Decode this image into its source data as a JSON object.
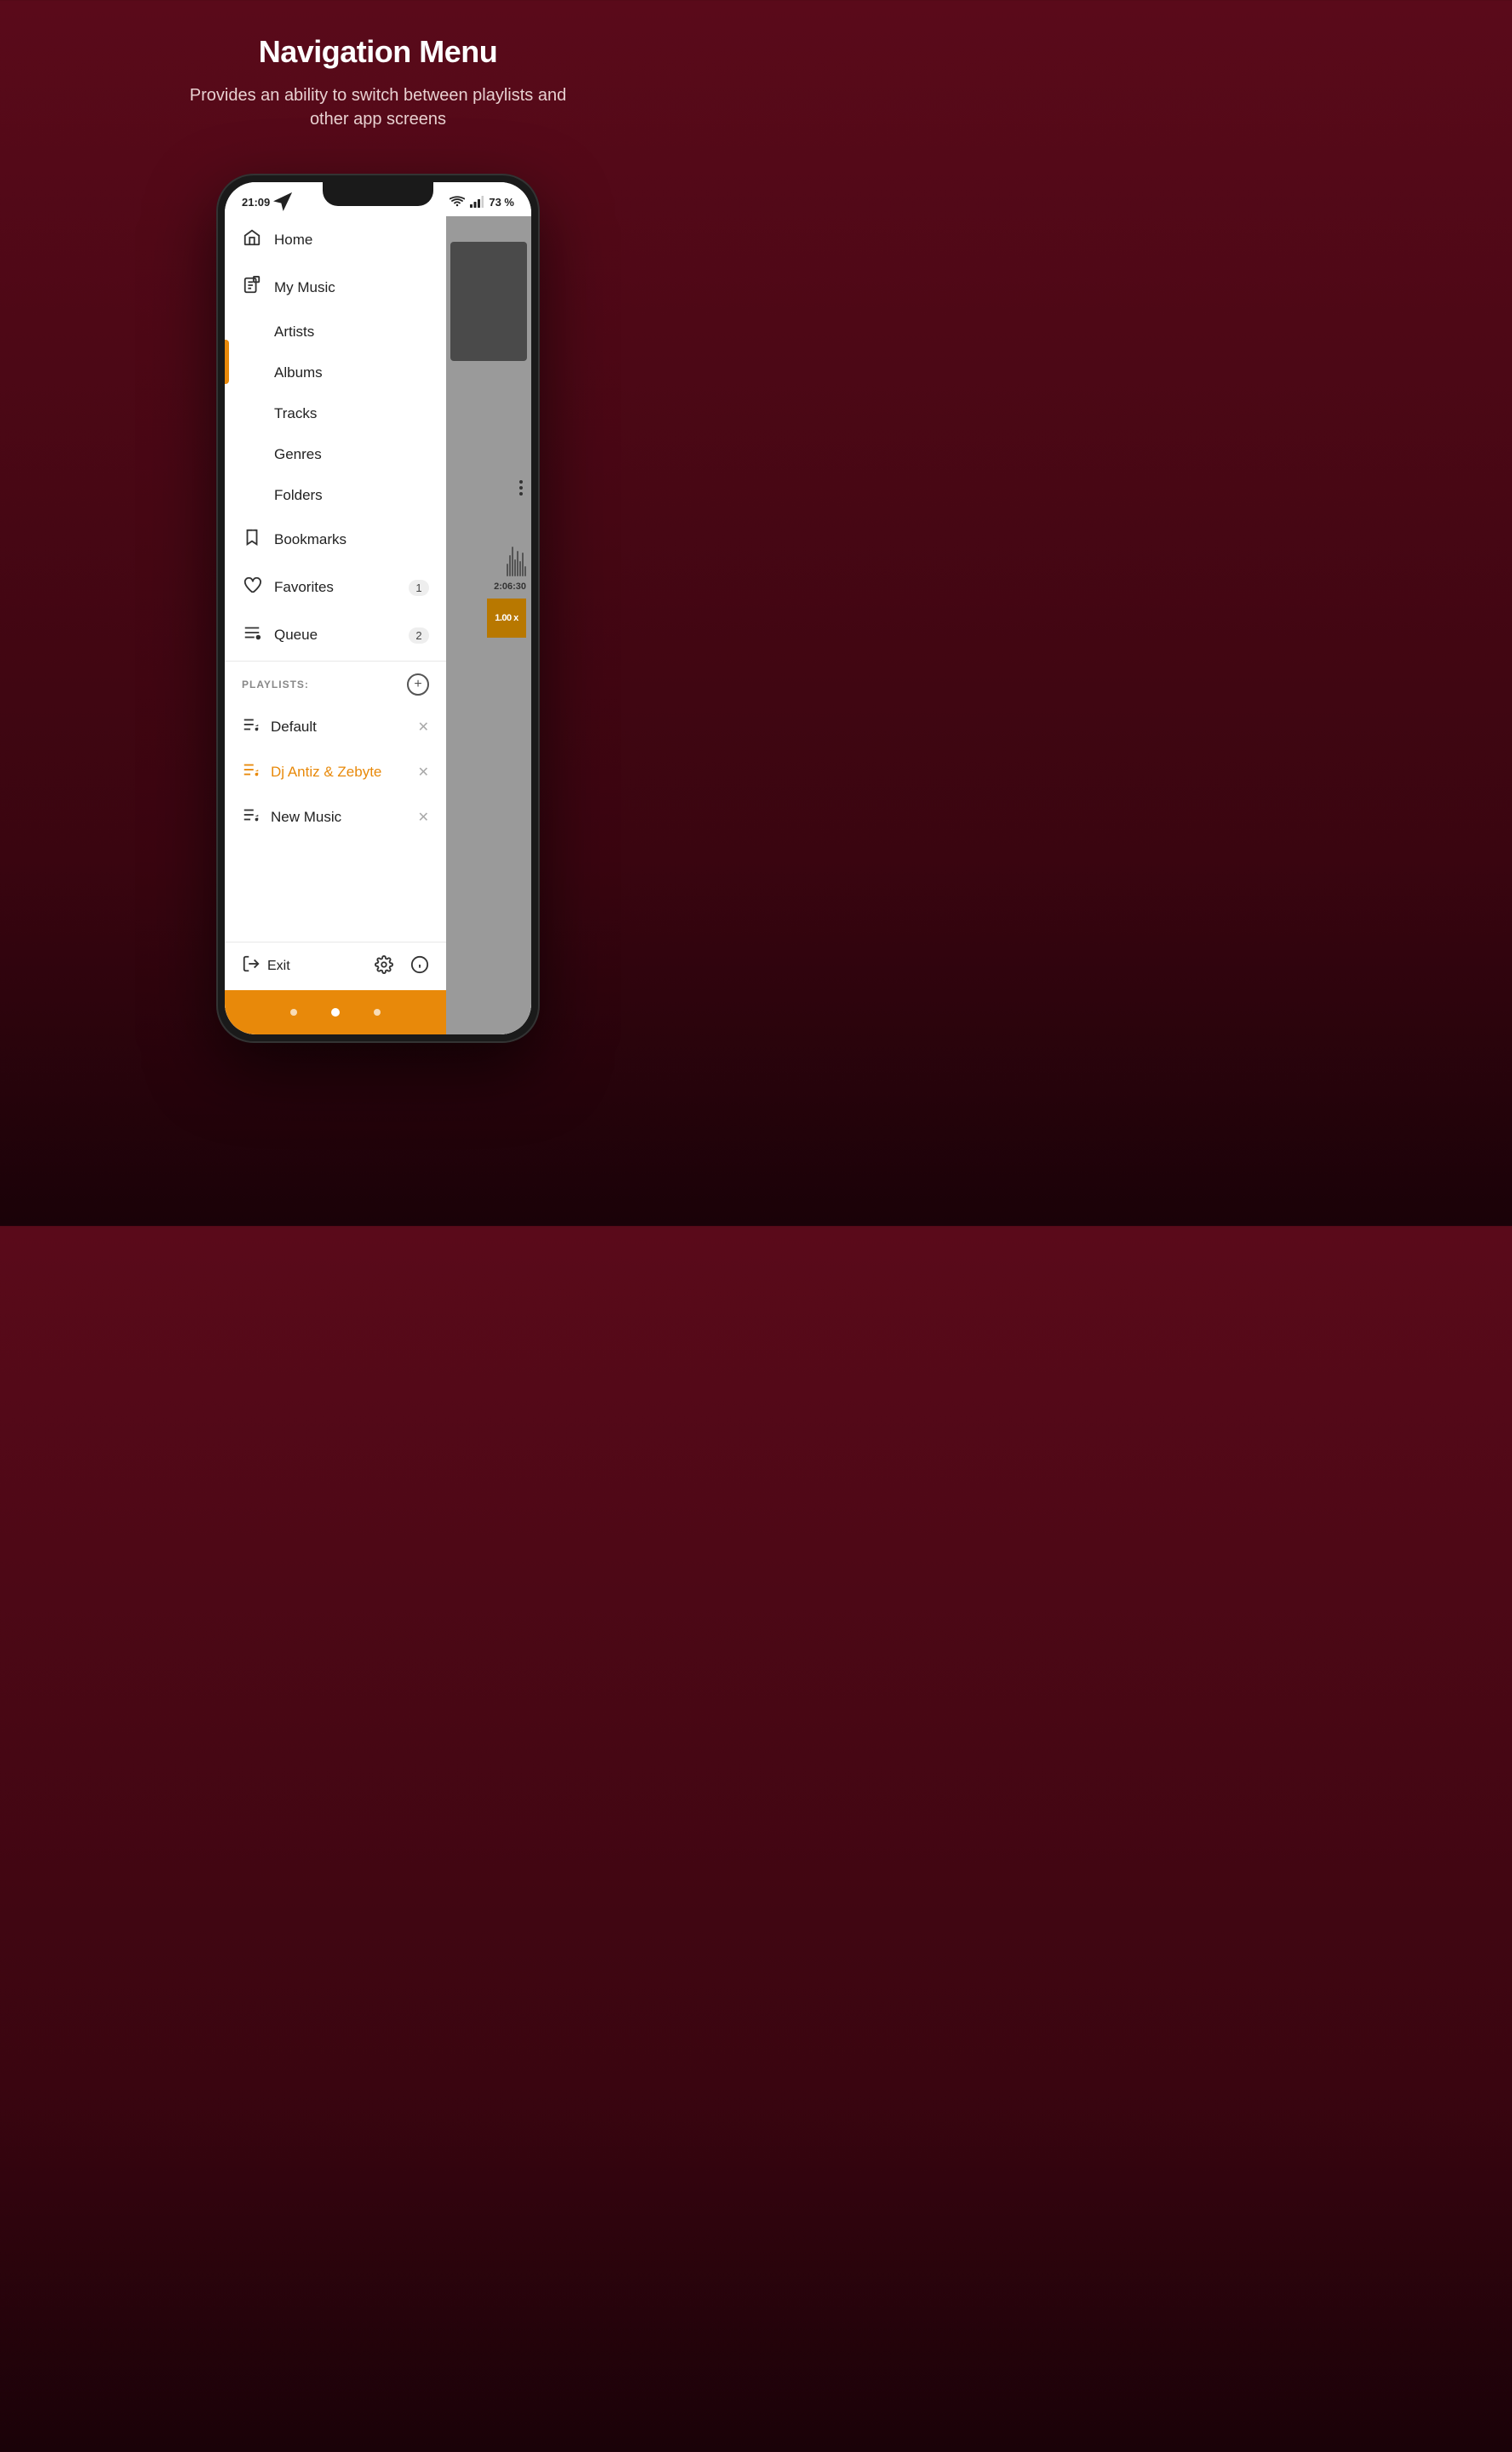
{
  "header": {
    "title": "Navigation Menu",
    "subtitle": "Provides an ability to switch between playlists and other app screens"
  },
  "status_bar": {
    "time": "21:09",
    "battery": "73 %",
    "wifi": true,
    "signal": true
  },
  "nav_items": [
    {
      "id": "home",
      "label": "Home",
      "icon": "home",
      "badge": null,
      "active": false
    },
    {
      "id": "my-music",
      "label": "My Music",
      "icon": "music-library",
      "badge": null,
      "active": false
    },
    {
      "id": "artists",
      "label": "Artists",
      "icon": null,
      "badge": null,
      "sub": true,
      "active": true
    },
    {
      "id": "albums",
      "label": "Albums",
      "icon": null,
      "badge": null,
      "sub": true,
      "active": false
    },
    {
      "id": "tracks",
      "label": "Tracks",
      "icon": null,
      "badge": null,
      "sub": true,
      "active": false
    },
    {
      "id": "genres",
      "label": "Genres",
      "icon": null,
      "badge": null,
      "sub": true,
      "active": false
    },
    {
      "id": "folders",
      "label": "Folders",
      "icon": null,
      "badge": null,
      "sub": true,
      "active": false
    },
    {
      "id": "bookmarks",
      "label": "Bookmarks",
      "icon": "bookmark",
      "badge": null,
      "active": false
    },
    {
      "id": "favorites",
      "label": "Favorites",
      "icon": "heart",
      "badge": "1",
      "active": false
    },
    {
      "id": "queue",
      "label": "Queue",
      "icon": "queue",
      "badge": "2",
      "active": false
    }
  ],
  "playlists_section": {
    "label": "PLAYLISTS:",
    "add_button_label": "+",
    "items": [
      {
        "id": "default",
        "name": "Default",
        "active": false
      },
      {
        "id": "dj-antiz",
        "name": "Dj Antiz & Zebyte",
        "active": true
      },
      {
        "id": "new-music",
        "name": "New Music",
        "active": false
      }
    ]
  },
  "bottom_bar": {
    "exit_label": "Exit",
    "settings_icon": "gear",
    "info_icon": "info"
  },
  "player_panel": {
    "time": "2:06:30",
    "speed": "1.00 x"
  },
  "colors": {
    "accent_orange": "#e8890a",
    "active_bar": "#e8890a",
    "background": "#5a0a1a",
    "white": "#ffffff",
    "badge_bg": "#eeeeee"
  }
}
